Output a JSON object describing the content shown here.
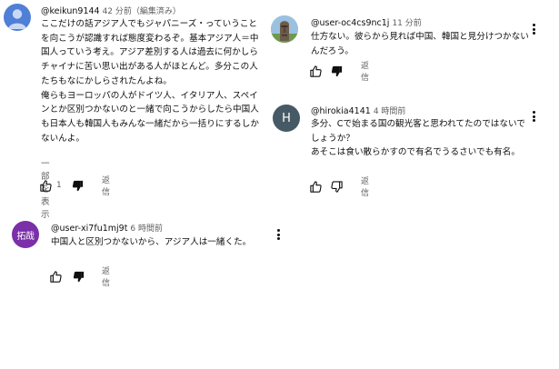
{
  "colors": {
    "avatar_keikun": "#4f7fd6",
    "avatar_hirokia": "#455a64",
    "avatar_user_xi": "#7b2fa8",
    "secondary_text": "#606060"
  },
  "comments": [
    {
      "author": "@keikun9144",
      "time": "42 分前（編集済み）",
      "text": "ここだけの話アジア人でもジャパニーズ・っていうことを向こうが認識すれば態度変わるぞ。基本アジア人＝中国人っていう考え。アジア差別する人は過去に何かしらチャイナに苦い思い出がある人がほとんど。多分この人たちもなにかしらされたんよね。\n俺らもヨーロッパの人がドイツ人、イタリア人、スペインとか区別つかないのと一緒で向こうからしたら中国人も日本人も韓国人もみんな一緒だから一括りにするしかないんよ。",
      "read_more": "一部を表示",
      "like_count": "1",
      "reply_label": "返信",
      "avatar_icon": "person-silhouette-icon"
    },
    {
      "author": "@user-oc4cs9nc1j",
      "time": "11 分前",
      "text": "仕方ない。彼らから見れば中国、韓国と見分けつかないんだろう。",
      "reply_label": "返信",
      "avatar_icon": "moai-statue-icon"
    },
    {
      "author": "@hirokia4141",
      "time": "4 時間前",
      "text": "多分、Cで始まる国の観光客と思われてたのではないでしょうか？\nあそこは食い散らかすので有名でうるさいでも有名。",
      "reply_label": "返信",
      "avatar_initial": "H"
    },
    {
      "author": "@user-xi7fu1mj9t",
      "time": "6 時間前",
      "text": "中国人と区別つかないから、アジア人は一緒くた。",
      "reply_label": "返信",
      "avatar_label": "拓哉"
    }
  ]
}
